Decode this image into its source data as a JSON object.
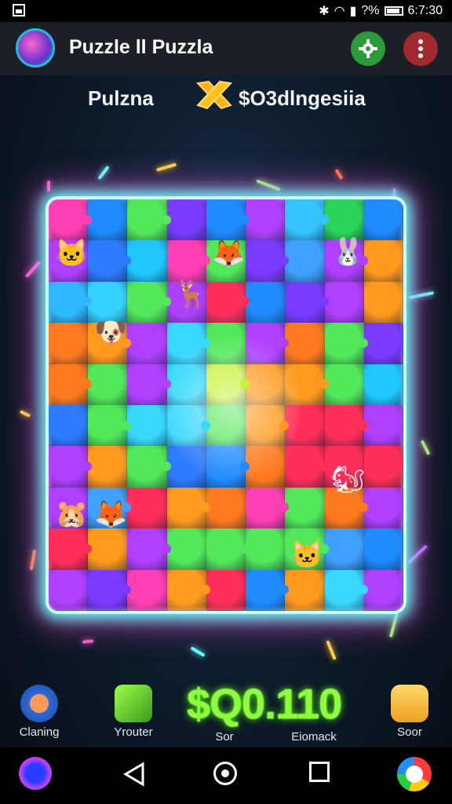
{
  "status_bar": {
    "battery_percent": "?%",
    "time": "6:7:30"
  },
  "app_bar": {
    "title": "Puzzle ll Puzzla"
  },
  "score": {
    "left_label": "Pulzna",
    "right_label": "$O3dlngesiia"
  },
  "board": {
    "columns": 9,
    "rows": 10,
    "colors": [
      "#ff3fb4",
      "#1f8bff",
      "#52e85a",
      "#7a3bff",
      "#1f8bff",
      "#b040ff",
      "#35c4ff",
      "#2bd45a",
      "#1f8bff",
      "#b040ff",
      "#2f7bff",
      "#1fc6ff",
      "#ff3fb4",
      "#52e85a",
      "#7a3bff",
      "#3fa0ff",
      "#b040ff",
      "#ff9a1f",
      "#2fb8ff",
      "#35d2ff",
      "#52e85a",
      "#b040ff",
      "#ff2f5a",
      "#1f8bff",
      "#7a3bff",
      "#b040ff",
      "#ff9a1f",
      "#ff7a1f",
      "#ff9a1f",
      "#b040ff",
      "#39d8ff",
      "#52e85a",
      "#b040ff",
      "#ff7a1f",
      "#52e85a",
      "#7a3bff",
      "#ff7a1f",
      "#52e85a",
      "#b040ff",
      "#39d8ff",
      "#c7f23a",
      "#ff9a1f",
      "#ff9a1f",
      "#52e85a",
      "#1fc6ff",
      "#2f7bff",
      "#52e85a",
      "#39d8ff",
      "#39d8ff",
      "#52e85a",
      "#ff9a1f",
      "#ff2f5a",
      "#ff2f5a",
      "#b040ff",
      "#b040ff",
      "#ff9a1f",
      "#52e85a",
      "#2f7bff",
      "#1f8bff",
      "#ff7a1f",
      "#ff2f5a",
      "#ff2f5a",
      "#ff2f5a",
      "#b040ff",
      "#3fa0ff",
      "#ff2f5a",
      "#ff9a1f",
      "#ff7a1f",
      "#ff3fb4",
      "#52e85a",
      "#ff7a1f",
      "#b040ff",
      "#ff2f5a",
      "#ff9a1f",
      "#b040ff",
      "#52e85a",
      "#52e85a",
      "#52e85a",
      "#52e85a",
      "#3fa0ff",
      "#1f8bff",
      "#b040ff",
      "#7a3bff",
      "#ff3fb4",
      "#ff9a1f",
      "#ff2f5a",
      "#1f8bff",
      "#ff9a1f",
      "#39d8ff",
      "#b040ff"
    ],
    "critters": [
      "🐱",
      "🦊",
      "🐰",
      "🐶",
      "🦌",
      "🐿",
      "🦊",
      "🐱",
      "🐹"
    ]
  },
  "bottom_bar": {
    "items": [
      {
        "label": "Claning",
        "icon": "character-icon"
      },
      {
        "label": "Yrouter",
        "icon": "dice-icon"
      },
      {
        "label": "Sor",
        "icon": "score-label"
      },
      {
        "label": "Eiomack",
        "icon": "score-label"
      },
      {
        "label": "Soor",
        "icon": "gift-icon"
      }
    ],
    "big_score": "$Q0.110"
  },
  "colors": {
    "accent_green": "#8cff3a",
    "gear_button": "#2a9a3a",
    "menu_button": "#a02a30",
    "board_glow": "#66ffff"
  }
}
